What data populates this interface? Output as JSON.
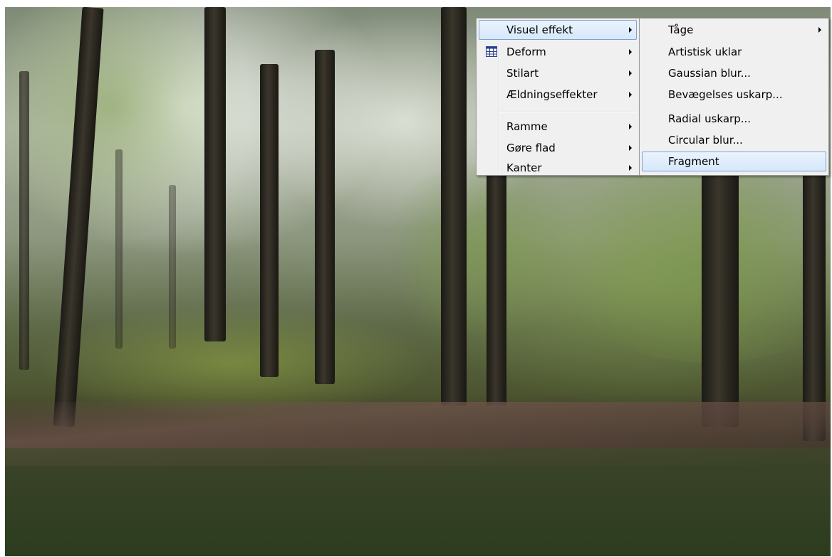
{
  "main_menu": {
    "items": [
      {
        "label": "Visuel effekt",
        "submenu": true,
        "highlighted": true
      },
      {
        "label": "Deform",
        "submenu": true,
        "icon": "grid-icon"
      },
      {
        "label": "Stilart",
        "submenu": true
      },
      {
        "label": "Ældningseffekter",
        "submenu": true
      },
      {
        "label": "Ramme",
        "submenu": true
      },
      {
        "label": "Gøre flad",
        "submenu": true
      },
      {
        "label": "Kanter",
        "submenu": true
      }
    ]
  },
  "sub_menu": {
    "items": [
      {
        "label": "Tåge",
        "submenu": true
      },
      {
        "label": "Artistisk uklar",
        "submenu": false
      },
      {
        "label": "Gaussian blur...",
        "submenu": false
      },
      {
        "label": "Bevægelses uskarp...",
        "submenu": false
      },
      {
        "label": "Radial uskarp...",
        "submenu": false
      },
      {
        "label": "Circular blur...",
        "submenu": false
      },
      {
        "label": "Fragment",
        "submenu": false,
        "highlighted": true
      }
    ]
  },
  "colors": {
    "menu_bg": "#f0f0f0",
    "highlight_border": "#7da2ce",
    "highlight_fill": "#d6e8fb"
  }
}
